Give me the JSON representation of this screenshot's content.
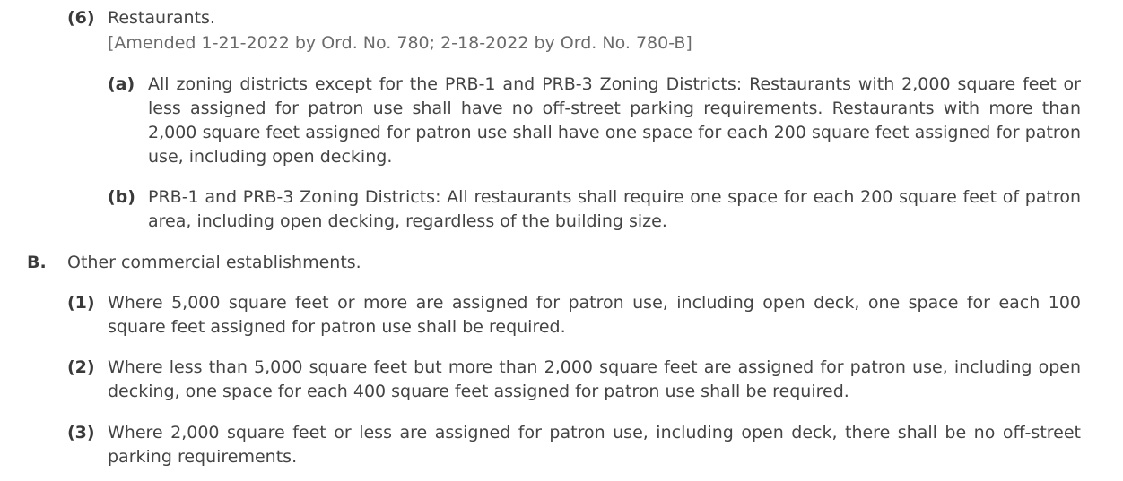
{
  "items": [
    {
      "marker": "(6)",
      "text": "Restaurants."
    },
    {
      "text": "[Amended 1-21-2022 by Ord. No. 780; 2-18-2022 by Ord. No. 780-B]"
    },
    {
      "marker": "(a)",
      "text": "All zoning districts except for the PRB-1 and PRB-3 Zoning Districts: Restaurants with 2,000 square feet or less assigned for patron use shall have no off-street parking requirements. Restaurants with more than 2,000 square feet assigned for patron use shall have one space for each 200 square feet assigned for patron use, including open decking."
    },
    {
      "marker": "(b)",
      "text": "PRB-1 and PRB-3 Zoning Districts: All restaurants shall require one space for each 200 square feet of patron area, including open decking, regardless of the building size."
    },
    {
      "marker": "B.",
      "text": "Other commercial establishments."
    },
    {
      "marker": "(1)",
      "text": "Where 5,000 square feet or more are assigned for patron use, including open deck, one space for each 100 square feet assigned for patron use shall be required."
    },
    {
      "marker": "(2)",
      "text": "Where less than 5,000 square feet but more than 2,000 square feet are assigned for patron use, including open decking, one space for each 400 square feet assigned for patron use shall be required."
    },
    {
      "marker": "(3)",
      "text": "Where 2,000 square feet or less are assigned for patron use, including open deck, there shall be no off-street parking requirements."
    }
  ]
}
